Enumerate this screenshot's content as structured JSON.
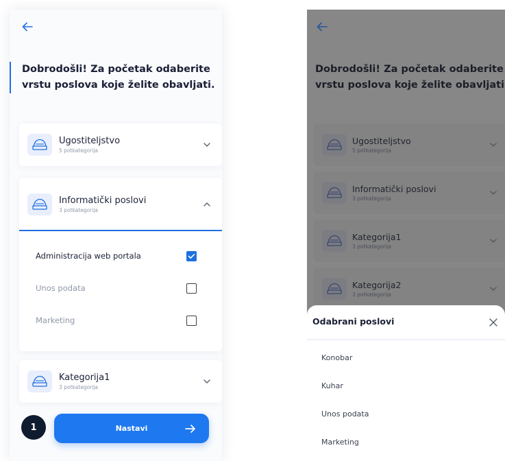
{
  "left": {
    "title": "Dobrodošli! Za početak odaberite vrstu poslova koje želite obavljati.",
    "categories": [
      {
        "name": "Ugostiteljstvo",
        "sub": "5 potkategorija",
        "expanded": false
      },
      {
        "name": "Informatički poslovi",
        "sub": "3 potkategorija",
        "expanded": true,
        "items": [
          {
            "label": "Administracija web portala",
            "checked": true
          },
          {
            "label": "Unos podata",
            "checked": false
          },
          {
            "label": "Marketing",
            "checked": false
          }
        ]
      },
      {
        "name": "Kategorija1",
        "sub": "3 potkategorija",
        "expanded": false
      }
    ],
    "step": "1",
    "continue_label": "Nastavi"
  },
  "right": {
    "title": "Dobrodošli! Za početak odaberite vrstu poslova koje želite obavljati.",
    "categories": [
      {
        "name": "Ugostiteljstvo",
        "sub": "5 potkategorija"
      },
      {
        "name": "Informatički poslovi",
        "sub": "3 potkategorija"
      },
      {
        "name": "Kategorija1",
        "sub": "3 potkategorija"
      },
      {
        "name": "Kategorija2",
        "sub": "3 potkategorija"
      }
    ],
    "sheet": {
      "title": "Odabrani poslovi",
      "items": [
        "Konobar",
        "Kuhar",
        "Unos podata",
        "Marketing"
      ]
    }
  },
  "colors": {
    "accent": "#1e78f0",
    "dark": "#0f1b2e",
    "overlay": "#878787"
  },
  "icons": {
    "back": "arrow-left-icon",
    "category": "category-icon",
    "chevron_down": "chevron-down-icon",
    "chevron_up": "chevron-up-icon",
    "check": "check-icon",
    "continue": "arrow-right-icon",
    "close": "close-icon"
  }
}
